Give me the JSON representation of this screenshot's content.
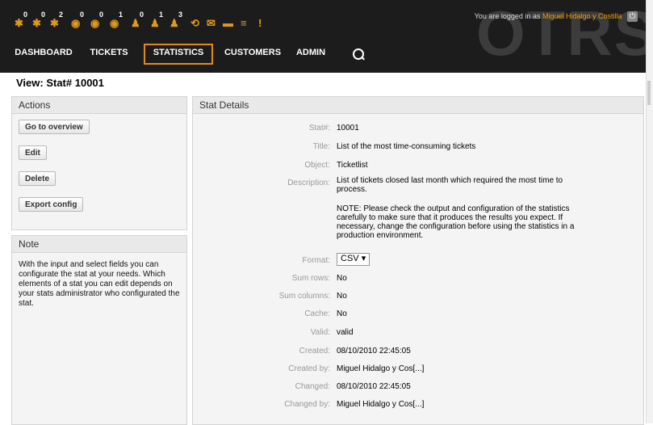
{
  "header": {
    "watermark": "OTRS",
    "login_prefix": "You are logged in as",
    "login_user": "Miguel Hidalgo y Costilla",
    "logout_icon": "power-icon",
    "toolbar": [
      {
        "name": "locked-tickets-new-icon",
        "glyph": "✱",
        "count": "0"
      },
      {
        "name": "locked-tickets-reminder-icon",
        "glyph": "✱",
        "count": "0"
      },
      {
        "name": "locked-tickets-total-icon",
        "glyph": "✱",
        "count": "2"
      },
      {
        "name": "watched-tickets-new-icon",
        "glyph": "◉",
        "count": "0"
      },
      {
        "name": "watched-tickets-reminder-icon",
        "glyph": "◉",
        "count": "0"
      },
      {
        "name": "watched-tickets-total-icon",
        "glyph": "◉",
        "count": "1"
      },
      {
        "name": "responsible-tickets-new-icon",
        "glyph": "♟",
        "count": "0"
      },
      {
        "name": "responsible-tickets-reminder-icon",
        "glyph": "♟",
        "count": "1"
      },
      {
        "name": "responsible-tickets-total-icon",
        "glyph": "♟",
        "count": "3"
      },
      {
        "name": "phone-ticket-icon",
        "glyph": "⟲",
        "count": ""
      },
      {
        "name": "email-ticket-icon",
        "glyph": "✉",
        "count": ""
      },
      {
        "name": "ticket-search-icon",
        "glyph": "▬",
        "count": ""
      },
      {
        "name": "queue-view-icon",
        "glyph": "≡",
        "count": ""
      },
      {
        "name": "escalated-tickets-icon",
        "glyph": "!",
        "count": ""
      }
    ],
    "nav": [
      "DASHBOARD",
      "TICKETS",
      "STATISTICS",
      "CUSTOMERS",
      "ADMIN"
    ],
    "search_icon": "search-icon"
  },
  "page": {
    "title": "View: Stat# 10001"
  },
  "actions": {
    "heading": "Actions",
    "buttons": [
      "Go to overview",
      "Edit",
      "Delete",
      "Export config"
    ]
  },
  "note": {
    "heading": "Note",
    "text": "With the input and select fields you can configurate the stat at your needs. Which elements of a stat you can edit depends on your stats administrator who configurated the stat."
  },
  "details": {
    "heading": "Stat Details",
    "rows": [
      {
        "label": "Stat#:",
        "value": "10001"
      },
      {
        "label": "Title:",
        "value": "List of the most time-consuming tickets"
      },
      {
        "label": "Object:",
        "value": "Ticketlist"
      },
      {
        "label": "Description:",
        "value": "List of tickets closed last month which required the most time to process.",
        "note": "NOTE: Please check the output and configuration of the statistics carefully to make sure that it produces the results you expect. If necessary, change the configuration before using the statistics in a production environment."
      },
      {
        "label": "Format:",
        "value": "CSV"
      },
      {
        "label": "Sum rows:",
        "value": "No"
      },
      {
        "label": "Sum columns:",
        "value": "No"
      },
      {
        "label": "Cache:",
        "value": "No"
      },
      {
        "label": "Valid:",
        "value": "valid"
      },
      {
        "label": "Created:",
        "value": "08/10/2010 22:45:05"
      },
      {
        "label": "Created by:",
        "value": "Miguel Hidalgo y Cos[...]"
      },
      {
        "label": "Changed:",
        "value": "08/10/2010 22:45:05"
      },
      {
        "label": "Changed by:",
        "value": "Miguel Hidalgo y Cos[...]"
      }
    ]
  }
}
